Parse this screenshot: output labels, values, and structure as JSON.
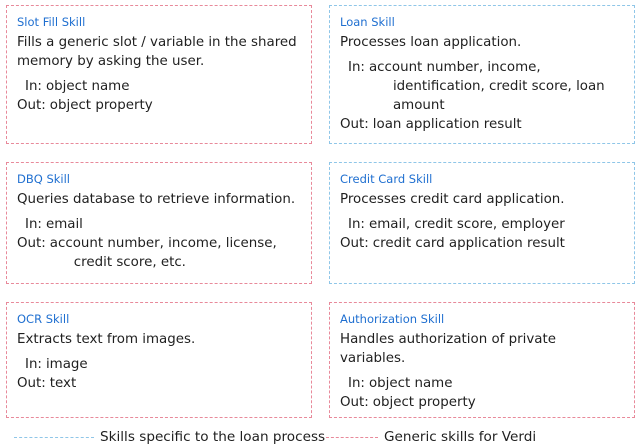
{
  "cards": [
    {
      "title": "Slot Fill Skill",
      "description": "Fills a generic slot / variable in the shared memory by asking the user.",
      "in_label": "In:",
      "in_value": "object name",
      "out_label": "Out:",
      "out_value": "object property",
      "category": "generic",
      "border_color": "#e8899a"
    },
    {
      "title": "Loan Skill",
      "description": "Processes loan application.",
      "in_label": "In:",
      "in_value": "account number, income, identification, credit score, loan amount",
      "out_label": "Out:",
      "out_value": "loan application result",
      "category": "loan",
      "border_color": "#8fc6e8"
    },
    {
      "title": "DBQ Skill",
      "description": "Queries database to retrieve information.",
      "in_label": "In:",
      "in_value": "email",
      "out_label": "Out:",
      "out_value": "account number, income, license, credit score, etc.",
      "category": "generic",
      "border_color": "#e8899a"
    },
    {
      "title": "Credit Card Skill",
      "description": "Processes credit card application.",
      "in_label": "In:",
      "in_value": "email, credit score, employer",
      "out_label": "Out:",
      "out_value": "credit card application result",
      "category": "loan",
      "border_color": "#8fc6e8"
    },
    {
      "title": "OCR Skill",
      "description": "Extracts text from images.",
      "in_label": "In:",
      "in_value": "image",
      "out_label": "Out:",
      "out_value": "text",
      "category": "generic",
      "border_color": "#e8899a"
    },
    {
      "title": "Authorization Skill",
      "description": "Handles authorization of private variables.",
      "in_label": "In:",
      "in_value": "object name",
      "out_label": "Out:",
      "out_value": "object property",
      "category": "generic",
      "border_color": "#e8899a"
    }
  ],
  "legend": {
    "loan_label": "Skills specific to the loan process",
    "generic_label": "Generic skills for Verdi"
  },
  "colors": {
    "title": "#1f6fd0",
    "loan_border": "#8fc6e8",
    "generic_border": "#e8899a"
  }
}
